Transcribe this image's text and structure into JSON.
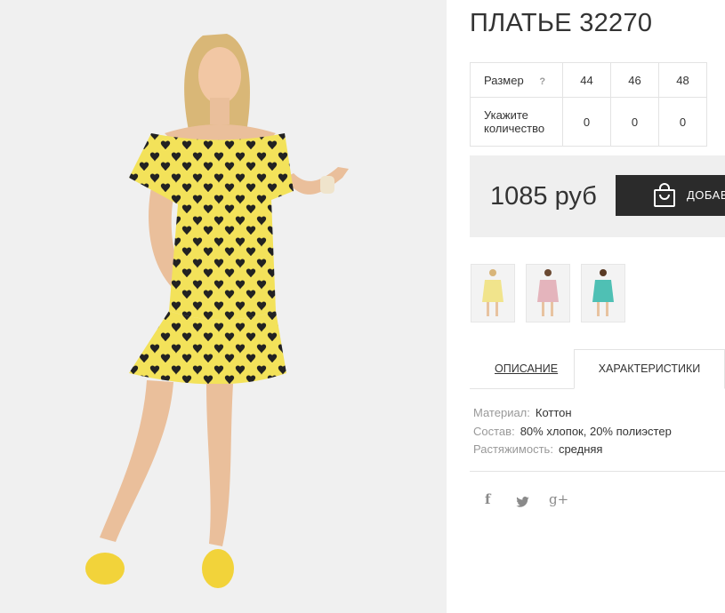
{
  "product": {
    "title": "ПЛАТЬЕ 32270",
    "photo_alt": "Желтое платье в черные сердечки"
  },
  "size_table": {
    "size_label": "Размер",
    "help_icon": "?",
    "sizes": [
      "44",
      "46",
      "48"
    ],
    "qty_label_line1": "Укажите",
    "qty_label_line2": "количество",
    "quantities": [
      "0",
      "0",
      "0"
    ]
  },
  "price": {
    "value": "1085 руб",
    "add_button_label": "ДОБАВИТЬ В КОРЗИНУ",
    "bag_icon": "shopping-bag-icon"
  },
  "thumbnails": [
    {
      "name": "yellow-dress",
      "color": "#f1e48c"
    },
    {
      "name": "pink-dress",
      "color": "#e4b4bc"
    },
    {
      "name": "teal-dress",
      "color": "#4fc0b4"
    }
  ],
  "tabs": {
    "description": "ОПИСАНИЕ",
    "characteristics": "ХАРАКТЕРИСТИКИ"
  },
  "specs": [
    {
      "key": "Материал:",
      "value": "Коттон"
    },
    {
      "key": "Состав:",
      "value": "80% хлопок, 20% полиэстер"
    },
    {
      "key": "Растяжимость:",
      "value": "средняя"
    }
  ],
  "social": {
    "facebook": "f",
    "twitter": "twitter-icon",
    "googleplus": "g+"
  },
  "colors": {
    "dress_yellow": "#f3e25a",
    "button_dark": "#2b2b2b",
    "price_bg": "#efefef"
  }
}
